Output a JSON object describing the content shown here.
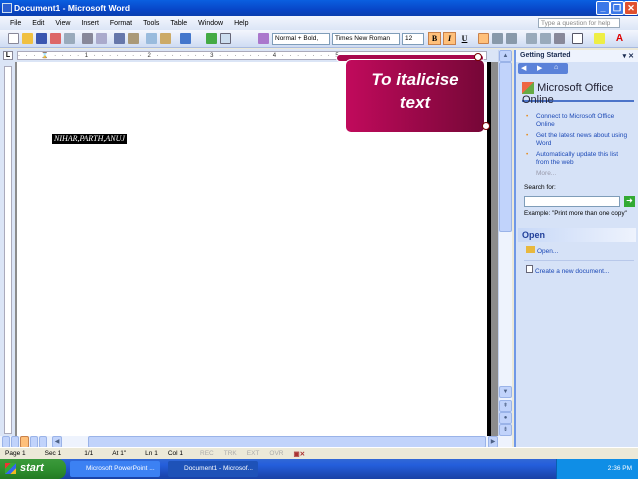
{
  "window": {
    "title": "Document1 - Microsoft Word"
  },
  "menu": [
    "File",
    "Edit",
    "View",
    "Insert",
    "Format",
    "Tools",
    "Table",
    "Window",
    "Help"
  ],
  "help_placeholder": "Type a question for help",
  "toolbar": {
    "style": "Normal + Bold,",
    "font": "Times New Roman",
    "size": "12",
    "bold": "B",
    "italic": "I",
    "underline": "U"
  },
  "ruler": {
    "marks": "· · · ⌛ · · · · 1 · · · · · · · 2 · · · · · · · 3 · · · · · · · 4 · · · · · · · 5"
  },
  "document": {
    "selected_text": "NIHAR,PARTH,ANUJ"
  },
  "callout": {
    "text_line1": "To italicise",
    "text_line2": "text"
  },
  "task_pane": {
    "title": "Getting Started",
    "logo": "Microsoft Office Online",
    "links": [
      "Connect to Microsoft Office Online",
      "Get the latest news about using Word",
      "Automatically update this list from the web"
    ],
    "more": "More...",
    "search_label": "Search for:",
    "search_value": "",
    "example": "Example:  \"Print more than one copy\"",
    "open_heading": "Open",
    "open_link": "Open...",
    "new_doc_link": "Create a new document..."
  },
  "status": {
    "page": "Page 1",
    "sec": "Sec 1",
    "pages": "1/1",
    "at": "At 1\"",
    "ln": "Ln 1",
    "col": "Col 1",
    "rec": "REC",
    "trk": "TRK",
    "ext": "EXT",
    "ovr": "OVR"
  },
  "taskbar": {
    "start": "start",
    "tasks": [
      "Microsoft PowerPoint ...",
      "Document1 - Microsof..."
    ],
    "clock": "2:36 PM"
  }
}
